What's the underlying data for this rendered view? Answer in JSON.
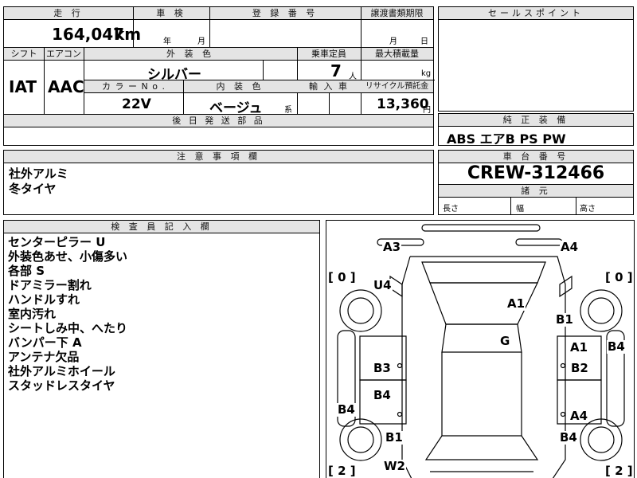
{
  "top": {
    "mileage_label": "走 行",
    "mileage_value": "164,047",
    "mileage_unit": "km",
    "inspection_label": "車 検",
    "inspection_year": "年",
    "inspection_month": "月",
    "registration_label": "登 録 番 号",
    "transfer_label": "譲渡書類期限",
    "transfer_month": "月",
    "transfer_day": "日",
    "shift_label": "シフト",
    "shift_value": "IAT",
    "ac_label": "エアコン",
    "ac_value": "AAC",
    "exterior_color_label": "外 装 色",
    "exterior_color_value": "シルバー",
    "color_no_label": "カ ラ ー N o .",
    "color_no_value": "22V",
    "interior_color_label": "内 装 色",
    "interior_color_value": "ベージュ",
    "interior_suffix": "系",
    "capacity_label": "乗車定員",
    "capacity_value": "7",
    "capacity_unit": "人",
    "import_label": "輸 入 車",
    "max_load_label": "最大積載量",
    "max_load_unit": "kg",
    "recycle_label": "リサイクル預託金",
    "recycle_value": "13,360",
    "recycle_unit": "円",
    "later_parts_label": "後 日 発 送 部 品"
  },
  "selling_point": {
    "label": "セールスポイント"
  },
  "equipment": {
    "label": "純 正 装 備",
    "value": "ABS エアB PS PW"
  },
  "notes": {
    "label": "注 意 事 項 欄",
    "lines": [
      "社外アルミ",
      "冬タイヤ"
    ]
  },
  "chassis": {
    "label": "車 台 番 号",
    "value": "CREW-312466",
    "dims_label": "諸 元",
    "length_label": "長さ",
    "width_label": "幅",
    "height_label": "高さ"
  },
  "inspector": {
    "label": "検 査 員 記 入 欄",
    "lines": [
      "センターピラー U",
      "外装色あせ、小傷多い",
      "各部 S",
      "ドアミラー割れ",
      "ハンドルすれ",
      "室内汚れ",
      "シートしみ中、へたり",
      "バンパー下 A",
      "アンテナ欠品",
      "社外アルミホイール",
      "スタッドレスタイヤ"
    ]
  },
  "diagram": {
    "marks": {
      "a3": "A3",
      "a4_top": "A4",
      "u4": "U4",
      "a1_roof": "A1",
      "b1_right": "B1",
      "g": "G",
      "a1_door": "A1",
      "b4_right": "B4",
      "b3": "B3",
      "b2": "B2",
      "b4_left_door": "B4",
      "b4_left": "B4",
      "a4_door": "A4",
      "b1_left": "B1",
      "b4_rear": "B4",
      "w2": "W2"
    },
    "tire_left_front": "0",
    "tire_right_front": "0",
    "tire_left_rear": "2",
    "tire_right_rear": "2"
  }
}
